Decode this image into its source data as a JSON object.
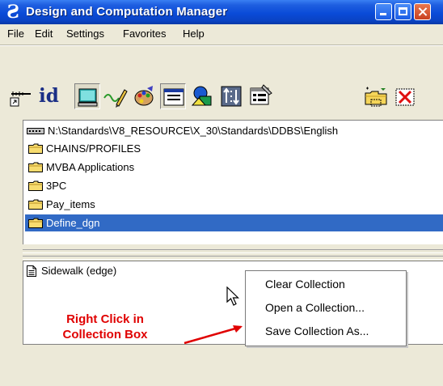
{
  "window": {
    "title": "Design and Computation Manager",
    "accent": "#0a4bd8"
  },
  "menubar": {
    "items": [
      {
        "label": "File"
      },
      {
        "label": "Edit"
      },
      {
        "label": "Settings"
      },
      {
        "label": "Favorites"
      },
      {
        "label": "Help"
      }
    ]
  },
  "toolbar": {
    "id_label": "id",
    "tools": [
      {
        "icon": "shortcut-dimension-icon"
      },
      {
        "icon": "id-icon"
      },
      {
        "icon": "monitor-icon",
        "pressed": true
      },
      {
        "icon": "pencil-draw-icon"
      },
      {
        "icon": "palette-icon"
      },
      {
        "icon": "dialog-window-icon",
        "pressed": true
      },
      {
        "icon": "shapes-icon"
      },
      {
        "icon": "compare-arrows-icon"
      },
      {
        "icon": "properties-icon"
      },
      {
        "icon": "new-folder-icon"
      },
      {
        "icon": "delete-x-icon"
      }
    ]
  },
  "path_list": {
    "root_path": "N:\\Standards\\V8_RESOURCE\\X_30\\Standards\\DDBS\\English",
    "folders": [
      {
        "label": "CHAINS/PROFILES",
        "selected": false
      },
      {
        "label": "MVBA Applications",
        "selected": false
      },
      {
        "label": "3PC",
        "selected": false
      },
      {
        "label": "Pay_items",
        "selected": false
      },
      {
        "label": "Define_dgn",
        "selected": true
      }
    ],
    "selection_color": "#316ac5"
  },
  "collection_box": {
    "items": [
      {
        "label": "Sidewalk (edge)"
      }
    ]
  },
  "annotation": {
    "line1": "Right Click in",
    "line2": "Collection Box",
    "color": "#e00000"
  },
  "context_menu": {
    "items": [
      {
        "label": "Clear Collection"
      },
      {
        "label": "Open a Collection..."
      },
      {
        "label": "Save Collection As..."
      }
    ]
  }
}
